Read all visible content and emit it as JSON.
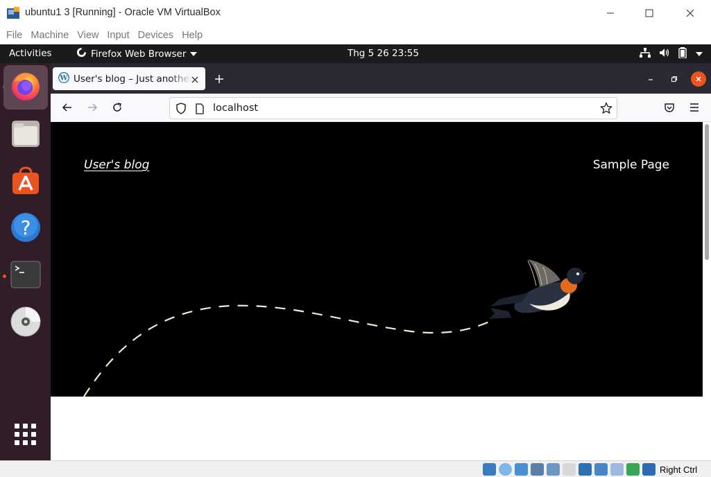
{
  "vbox": {
    "title": "ubuntu1 3 [Running] - Oracle VM VirtualBox",
    "menu": [
      "File",
      "Machine",
      "View",
      "Input",
      "Devices",
      "Help"
    ],
    "host_key": "Right Ctrl",
    "status_icons": [
      "hard-disk-icon",
      "optical-drive-icon",
      "audio-icon",
      "network-icon",
      "usb-icon",
      "shared-folder-icon",
      "display-icon",
      "recording-icon",
      "snapshot-icon",
      "cpu-icon",
      "mouse-integration-icon",
      "keyboard-icon"
    ]
  },
  "topbar": {
    "activities": "Activities",
    "app_name": "Firefox Web Browser",
    "clock": "Thg 5 26  23:55",
    "tray_icons": [
      "network-icon",
      "volume-icon",
      "battery-icon",
      "power-menu-icon"
    ]
  },
  "dock": {
    "items": [
      {
        "name": "firefox",
        "running": true,
        "active": true
      },
      {
        "name": "files",
        "running": false
      },
      {
        "name": "ubuntu-software",
        "running": false
      },
      {
        "name": "help",
        "running": false
      },
      {
        "name": "terminal",
        "running": true
      },
      {
        "name": "dvd",
        "running": false
      }
    ],
    "show_apps_icon": "grid-icon"
  },
  "firefox": {
    "tab_title": "User's blog – Just another WordPress site",
    "url": "localhost"
  },
  "page": {
    "site_title": "User's blog",
    "nav_item": "Sample Page"
  },
  "colors": {
    "ubuntu_orange": "#e95420",
    "dock_bg": "#311d27",
    "firefox_tabbar": "#2b2a33",
    "hero_bg": "#000000"
  }
}
